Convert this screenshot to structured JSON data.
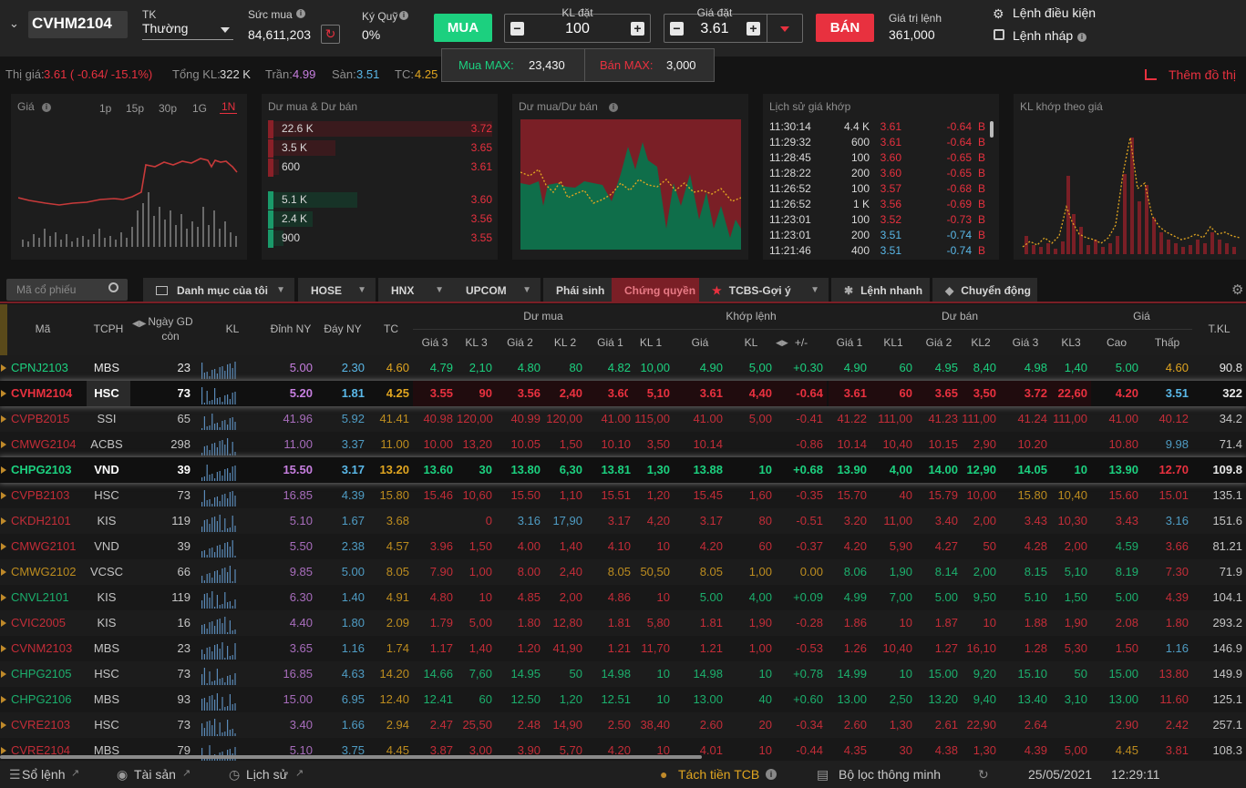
{
  "colors": {
    "up": "#1cd07f",
    "down": "#e8313f",
    "ref": "#e0a520",
    "ceil": "#c77fe0",
    "floor": "#5ab8e8",
    "accent": "#e8313f"
  },
  "order": {
    "symbol": "CVHM2104",
    "account_label": "TK",
    "account_value": "Thường",
    "buying_power_label": "Sức mua",
    "buying_power_value": "84,611,203",
    "margin_label": "Ký Quỹ",
    "margin_value": "0%",
    "buy_label": "MUA",
    "qty_label": "KL đặt",
    "qty_value": "100",
    "price_label": "Giá đặt",
    "price_value": "3.61",
    "sell_label": "BÁN",
    "order_value_label": "Giá trị lệnh",
    "order_value": "361,000",
    "conditional_order": "Lệnh điều kiện",
    "draft_order": "Lệnh nháp",
    "buy_max_label": "Mua MAX:",
    "buy_max": "23,430",
    "sell_max_label": "Bán MAX:",
    "sell_max": "3,000"
  },
  "quote": {
    "price_label": "Thị giá:",
    "price": "3.61 ( -0.64/ -15.1%)",
    "vol_label": "Tổng KL:",
    "vol": "322 K",
    "ceil_label": "Trần:",
    "ceil": "4.99",
    "floor_label": "Sàn:",
    "floor": "3.51",
    "ref_label": "TC:",
    "ref": "4.25",
    "more_charts": "Thêm đồ thị"
  },
  "panels": {
    "price_title": "Giá",
    "ranges": [
      "1p",
      "15p",
      "30p",
      "1G",
      "1N"
    ],
    "depth_title": "Dư mua & Dư bán",
    "depth": [
      {
        "vol": "22.6 K",
        "price": "3.72",
        "side": "ask",
        "level": 1.0
      },
      {
        "vol": "3.5 K",
        "price": "3.65",
        "side": "ask",
        "level": 0.3
      },
      {
        "vol": "600",
        "price": "3.61",
        "side": "ask",
        "level": 0.05
      },
      {
        "vol": "5.1 K",
        "price": "3.60",
        "side": "bid",
        "level": 0.4
      },
      {
        "vol": "2.4 K",
        "price": "3.56",
        "side": "bid",
        "level": 0.2
      },
      {
        "vol": "900",
        "price": "3.55",
        "side": "bid",
        "level": 0.07
      }
    ],
    "bidask_title": "Dư mua/Dư bán",
    "history_title": "Lịch sử giá khớp",
    "history": [
      {
        "t": "11:30:14",
        "v": "4.4 K",
        "p": "3.61",
        "c": "-0.64",
        "s": "B",
        "col": "down"
      },
      {
        "t": "11:29:32",
        "v": "600",
        "p": "3.61",
        "c": "-0.64",
        "s": "B",
        "col": "down"
      },
      {
        "t": "11:28:45",
        "v": "100",
        "p": "3.60",
        "c": "-0.65",
        "s": "B",
        "col": "down"
      },
      {
        "t": "11:28:22",
        "v": "200",
        "p": "3.60",
        "c": "-0.65",
        "s": "B",
        "col": "down"
      },
      {
        "t": "11:26:52",
        "v": "100",
        "p": "3.57",
        "c": "-0.68",
        "s": "B",
        "col": "down"
      },
      {
        "t": "11:26:52",
        "v": "1 K",
        "p": "3.56",
        "c": "-0.69",
        "s": "B",
        "col": "down"
      },
      {
        "t": "11:23:01",
        "v": "100",
        "p": "3.52",
        "c": "-0.73",
        "s": "B",
        "col": "down"
      },
      {
        "t": "11:23:01",
        "v": "200",
        "p": "3.51",
        "c": "-0.74",
        "s": "B",
        "col": "floor"
      },
      {
        "t": "11:21:46",
        "v": "400",
        "p": "3.51",
        "c": "-0.74",
        "s": "B",
        "col": "floor"
      }
    ],
    "volprice_title": "KL khớp theo giá"
  },
  "tabs": {
    "search_placeholder": "Mã cổ phiếu",
    "items": [
      "Danh mục của tôi",
      "HOSE",
      "HNX",
      "UPCOM",
      "Phái sinh",
      "Chứng quyền",
      "TCBS-Gợi ý",
      "Lệnh nhanh",
      "Chuyển động"
    ]
  },
  "header": {
    "ma": "Mã",
    "tcph": "TCPH",
    "ngaygd": "Ngày GD",
    "con": "còn",
    "kl": "KL",
    "dinhny": "Đỉnh NY",
    "dayny": "Đáy NY",
    "tc": "TC",
    "dumua": "Dư mua",
    "khoplenh": "Khớp lệnh",
    "duban": "Dư bán",
    "gia": "Giá",
    "tkl": "T.KL",
    "sub": [
      "Giá 3",
      "KL 3",
      "Giá 2",
      "KL 2",
      "Giá 1",
      "KL 1",
      "Giá",
      "KL",
      "+/-",
      "Giá 1",
      "KL1",
      "Giá 2",
      "KL2",
      "Giá 3",
      "KL3",
      "Cao",
      "Thấp"
    ]
  },
  "rows": [
    {
      "c": [
        "CPNJ2103",
        "MBS",
        "23",
        "5.00",
        "2.30",
        "4.60",
        "4.79",
        "2,10",
        "4.80",
        "80",
        "4.82",
        "10,00",
        "4.90",
        "5,00",
        "+0.30",
        "4.90",
        "60",
        "4.95",
        "8,40",
        "4.98",
        "1,40",
        "5.00",
        "4.60",
        "90.8"
      ],
      "k": [
        "up",
        "n",
        "n",
        "ceil",
        "floor",
        "ref",
        "up",
        "up",
        "up",
        "up",
        "up",
        "up",
        "up",
        "up",
        "up",
        "up",
        "up",
        "up",
        "up",
        "up",
        "up",
        "up",
        "ref",
        "n"
      ]
    },
    {
      "c": [
        "CVHM2104",
        "HSC",
        "73",
        "5.20",
        "1.81",
        "4.25",
        "3.55",
        "90",
        "3.56",
        "2,40",
        "3.60",
        "5,10",
        "3.61",
        "4,40",
        "-0.64",
        "3.61",
        "60",
        "3.65",
        "3,50",
        "3.72",
        "22,60",
        "4.20",
        "3.51",
        "322"
      ],
      "k": [
        "down",
        "n",
        "n",
        "ceil",
        "floor",
        "ref",
        "down",
        "down",
        "down",
        "down",
        "down",
        "down",
        "down",
        "down",
        "down",
        "down",
        "down",
        "down",
        "down",
        "down",
        "down",
        "down",
        "floor",
        "n"
      ]
    },
    {
      "c": [
        "CVPB2015",
        "SSI",
        "65",
        "41.96",
        "5.92",
        "41.41",
        "40.98",
        "120,00",
        "40.99",
        "120,00",
        "41.00",
        "115,00",
        "41.00",
        "5,00",
        "-0.41",
        "41.22",
        "111,00",
        "41.23",
        "111,00",
        "41.24",
        "111,00",
        "41.00",
        "40.12",
        "34.2"
      ],
      "k": [
        "down",
        "n",
        "n",
        "ceil",
        "floor",
        "ref",
        "down",
        "down",
        "down",
        "down",
        "down",
        "down",
        "down",
        "down",
        "down",
        "down",
        "down",
        "down",
        "down",
        "down",
        "down",
        "down",
        "down",
        "n"
      ]
    },
    {
      "c": [
        "CMWG2104",
        "ACBS",
        "298",
        "11.00",
        "3.37",
        "11.00",
        "10.00",
        "13,20",
        "10.05",
        "1,50",
        "10.10",
        "3,50",
        "10.14",
        "",
        "-0.86",
        "10.14",
        "10,40",
        "10.15",
        "2,90",
        "10.20",
        "",
        "10.80",
        "9.98",
        "71.4"
      ],
      "k": [
        "down",
        "n",
        "n",
        "ceil",
        "floor",
        "ref",
        "down",
        "down",
        "down",
        "down",
        "down",
        "down",
        "down",
        "down",
        "down",
        "down",
        "down",
        "down",
        "down",
        "down",
        "down",
        "down",
        "floor",
        "n"
      ]
    },
    {
      "c": [
        "CHPG2103",
        "VND",
        "39",
        "15.50",
        "3.17",
        "13.20",
        "13.60",
        "30",
        "13.80",
        "6,30",
        "13.81",
        "1,30",
        "13.88",
        "10",
        "+0.68",
        "13.90",
        "4,00",
        "14.00",
        "12,90",
        "14.05",
        "10",
        "13.90",
        "12.70",
        "109.8"
      ],
      "k": [
        "up",
        "n",
        "n",
        "ceil",
        "floor",
        "ref",
        "up",
        "up",
        "up",
        "up",
        "up",
        "up",
        "up",
        "up",
        "up",
        "up",
        "up",
        "up",
        "up",
        "up",
        "up",
        "up",
        "down",
        "n"
      ]
    },
    {
      "c": [
        "CVPB2103",
        "HSC",
        "73",
        "16.85",
        "4.39",
        "15.80",
        "15.46",
        "10,60",
        "15.50",
        "1,10",
        "15.51",
        "1,20",
        "15.45",
        "1,60",
        "-0.35",
        "15.70",
        "40",
        "15.79",
        "10,00",
        "15.80",
        "10,40",
        "15.60",
        "15.01",
        "135.1"
      ],
      "k": [
        "down",
        "n",
        "n",
        "ceil",
        "floor",
        "ref",
        "down",
        "down",
        "down",
        "down",
        "down",
        "down",
        "down",
        "down",
        "down",
        "down",
        "down",
        "down",
        "down",
        "ref",
        "ref",
        "down",
        "down",
        "n"
      ]
    },
    {
      "c": [
        "CKDH2101",
        "KIS",
        "119",
        "5.10",
        "1.67",
        "3.68",
        "",
        "0",
        "3.16",
        "17,90",
        "3.17",
        "4,20",
        "3.17",
        "80",
        "-0.51",
        "3.20",
        "11,00",
        "3.40",
        "2,00",
        "3.43",
        "10,30",
        "3.43",
        "3.16",
        "151.6"
      ],
      "k": [
        "down",
        "n",
        "n",
        "ceil",
        "floor",
        "ref",
        "down",
        "down",
        "floor",
        "floor",
        "down",
        "down",
        "down",
        "down",
        "down",
        "down",
        "down",
        "down",
        "down",
        "down",
        "down",
        "down",
        "floor",
        "n"
      ]
    },
    {
      "c": [
        "CMWG2101",
        "VND",
        "39",
        "5.50",
        "2.38",
        "4.57",
        "3.96",
        "1,50",
        "4.00",
        "1,40",
        "4.10",
        "10",
        "4.20",
        "60",
        "-0.37",
        "4.20",
        "5,90",
        "4.27",
        "50",
        "4.28",
        "2,00",
        "4.59",
        "3.66",
        "81.21"
      ],
      "k": [
        "down",
        "n",
        "n",
        "ceil",
        "floor",
        "ref",
        "down",
        "down",
        "down",
        "down",
        "down",
        "down",
        "down",
        "down",
        "down",
        "down",
        "down",
        "down",
        "down",
        "down",
        "down",
        "up",
        "down",
        "n"
      ]
    },
    {
      "c": [
        "CMWG2102",
        "VCSC",
        "66",
        "9.85",
        "5.00",
        "8.05",
        "7.90",
        "1,00",
        "8.00",
        "2,40",
        "8.05",
        "50,50",
        "8.05",
        "1,00",
        "0.00",
        "8.06",
        "1,90",
        "8.14",
        "2,00",
        "8.15",
        "5,10",
        "8.19",
        "7.30",
        "71.9"
      ],
      "k": [
        "ref",
        "n",
        "n",
        "ceil",
        "floor",
        "ref",
        "down",
        "down",
        "down",
        "down",
        "ref",
        "ref",
        "ref",
        "ref",
        "ref",
        "up",
        "up",
        "up",
        "up",
        "up",
        "up",
        "up",
        "down",
        "n"
      ]
    },
    {
      "c": [
        "CNVL2101",
        "KIS",
        "119",
        "6.30",
        "1.40",
        "4.91",
        "4.80",
        "10",
        "4.85",
        "2,00",
        "4.86",
        "10",
        "5.00",
        "4,00",
        "+0.09",
        "4.99",
        "7,00",
        "5.00",
        "9,50",
        "5.10",
        "1,50",
        "5.00",
        "4.39",
        "104.1"
      ],
      "k": [
        "up",
        "n",
        "n",
        "ceil",
        "floor",
        "ref",
        "down",
        "down",
        "down",
        "down",
        "down",
        "down",
        "up",
        "up",
        "up",
        "up",
        "up",
        "up",
        "up",
        "up",
        "up",
        "up",
        "down",
        "n"
      ]
    },
    {
      "c": [
        "CVIC2005",
        "KIS",
        "16",
        "4.40",
        "1.80",
        "2.09",
        "1.79",
        "5,00",
        "1.80",
        "12,80",
        "1.81",
        "5,80",
        "1.81",
        "1,90",
        "-0.28",
        "1.86",
        "10",
        "1.87",
        "10",
        "1.88",
        "1,90",
        "2.08",
        "1.80",
        "293.2"
      ],
      "k": [
        "down",
        "n",
        "n",
        "ceil",
        "floor",
        "ref",
        "down",
        "down",
        "down",
        "down",
        "down",
        "down",
        "down",
        "down",
        "down",
        "down",
        "down",
        "down",
        "down",
        "down",
        "down",
        "down",
        "down",
        "n"
      ]
    },
    {
      "c": [
        "CVNM2103",
        "MBS",
        "23",
        "3.65",
        "1.16",
        "1.74",
        "1.17",
        "1,40",
        "1.20",
        "41,90",
        "1.21",
        "11,70",
        "1.21",
        "1,00",
        "-0.53",
        "1.26",
        "10,40",
        "1.27",
        "16,10",
        "1.28",
        "5,30",
        "1.50",
        "1.16",
        "146.9"
      ],
      "k": [
        "down",
        "n",
        "n",
        "ceil",
        "floor",
        "ref",
        "down",
        "down",
        "down",
        "down",
        "down",
        "down",
        "down",
        "down",
        "down",
        "down",
        "down",
        "down",
        "down",
        "down",
        "down",
        "down",
        "floor",
        "n"
      ]
    },
    {
      "c": [
        "CHPG2105",
        "HSC",
        "73",
        "16.85",
        "4.63",
        "14.20",
        "14.66",
        "7,60",
        "14.95",
        "50",
        "14.98",
        "10",
        "14.98",
        "10",
        "+0.78",
        "14.99",
        "10",
        "15.00",
        "9,20",
        "15.10",
        "50",
        "15.00",
        "13.80",
        "149.9"
      ],
      "k": [
        "up",
        "n",
        "n",
        "ceil",
        "floor",
        "ref",
        "up",
        "up",
        "up",
        "up",
        "up",
        "up",
        "up",
        "up",
        "up",
        "up",
        "up",
        "up",
        "up",
        "up",
        "up",
        "up",
        "down",
        "n"
      ]
    },
    {
      "c": [
        "CHPG2106",
        "MBS",
        "93",
        "15.00",
        "6.95",
        "12.40",
        "12.41",
        "60",
        "12.50",
        "1,20",
        "12.51",
        "10",
        "13.00",
        "40",
        "+0.60",
        "13.00",
        "2,50",
        "13.20",
        "9,40",
        "13.40",
        "3,10",
        "13.00",
        "11.60",
        "125.1"
      ],
      "k": [
        "up",
        "n",
        "n",
        "ceil",
        "floor",
        "ref",
        "up",
        "up",
        "up",
        "up",
        "up",
        "up",
        "up",
        "up",
        "up",
        "up",
        "up",
        "up",
        "up",
        "up",
        "up",
        "up",
        "down",
        "n"
      ]
    },
    {
      "c": [
        "CVRE2103",
        "HSC",
        "73",
        "3.40",
        "1.66",
        "2.94",
        "2.47",
        "25,50",
        "2.48",
        "14,90",
        "2.50",
        "38,40",
        "2.60",
        "20",
        "-0.34",
        "2.60",
        "1,30",
        "2.61",
        "22,90",
        "2.64",
        "",
        "2.90",
        "2.42",
        "257.1"
      ],
      "k": [
        "down",
        "n",
        "n",
        "ceil",
        "floor",
        "ref",
        "down",
        "down",
        "down",
        "down",
        "down",
        "down",
        "down",
        "down",
        "down",
        "down",
        "down",
        "down",
        "down",
        "down",
        "down",
        "down",
        "down",
        "n"
      ]
    },
    {
      "c": [
        "CVRE2104",
        "MBS",
        "79",
        "5.10",
        "3.75",
        "4.45",
        "3.87",
        "3,00",
        "3.90",
        "5,70",
        "4.20",
        "10",
        "4.01",
        "10",
        "-0.44",
        "4.35",
        "30",
        "4.38",
        "1,30",
        "4.39",
        "5,00",
        "4.45",
        "3.81",
        "108.3"
      ],
      "k": [
        "down",
        "n",
        "n",
        "ceil",
        "floor",
        "ref",
        "down",
        "down",
        "down",
        "down",
        "down",
        "down",
        "down",
        "down",
        "down",
        "down",
        "down",
        "down",
        "down",
        "down",
        "down",
        "ref",
        "down",
        "n"
      ]
    }
  ],
  "status": {
    "order_book": "Sổ lệnh",
    "assets": "Tài sản",
    "history": "Lịch sử",
    "split_money": "Tách tiền TCB",
    "filter": "Bộ lọc thông minh",
    "date": "25/05/2021",
    "time": "12:29:11"
  }
}
